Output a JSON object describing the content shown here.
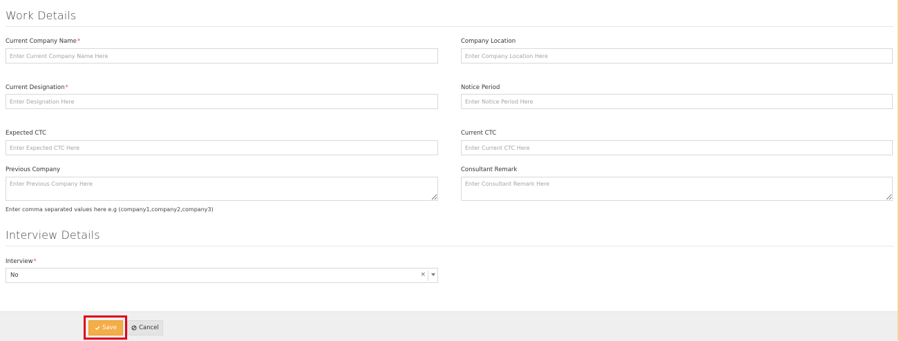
{
  "work_details": {
    "title": "Work Details",
    "current_company": {
      "label": "Current Company Name",
      "required": "*",
      "placeholder": "Enter Current Company Name Here"
    },
    "company_location": {
      "label": "Company Location",
      "placeholder": "Enter Company Location Here"
    },
    "current_designation": {
      "label": "Current Designation",
      "required": "*",
      "placeholder": "Enter Designation Here"
    },
    "notice_period": {
      "label": "Notice Period",
      "placeholder": "Enter Notice Period Here"
    },
    "expected_ctc": {
      "label": "Expected CTC",
      "placeholder": "Enter Expected CTC Here"
    },
    "current_ctc": {
      "label": "Current CTC",
      "placeholder": "Enter Current CTC Here"
    },
    "previous_company": {
      "label": "Previous Company",
      "placeholder": "Enter Previous Company Here",
      "help": "Enter comma separated values here e.g (company1,company2,company3)"
    },
    "consultant_remark": {
      "label": "Consultant Remark",
      "placeholder": "Enter Consultant Remark Here"
    }
  },
  "interview_details": {
    "title": "Interview Details",
    "interview": {
      "label": "Interview",
      "required": "*",
      "value": "No",
      "clear": "×"
    }
  },
  "footer": {
    "save_label": "Save",
    "cancel_label": "Cancel",
    "save_color": "#f4ad47",
    "highlight_color": "#e0001b"
  },
  "icons": {
    "save": "check-icon",
    "cancel": "ban-icon",
    "dropdown": "caret-down-icon",
    "clear": "clear-icon"
  }
}
